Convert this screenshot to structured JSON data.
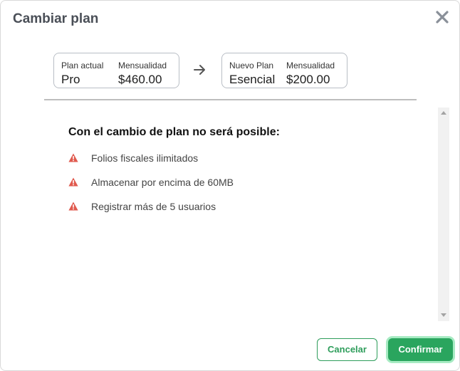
{
  "dialog": {
    "title": "Cambiar plan",
    "close_icon": "close-x-icon"
  },
  "current_plan": {
    "plan_label": "Plan actual",
    "plan_value": "Pro",
    "price_label": "Mensualidad",
    "price_value": "$460.00"
  },
  "transition_icon": "arrow-right-icon",
  "new_plan": {
    "plan_label": "Nuevo Plan",
    "plan_value": "Esencial",
    "price_label": "Mensualidad",
    "price_value": "$200.00"
  },
  "warnings": {
    "heading": "Con el cambio de plan no será posible:",
    "icon": "warning-triangle-icon",
    "items": [
      "Folios fiscales ilimitados",
      "Almacenar por encima de 60MB",
      "Registrar más de 5 usuarios"
    ]
  },
  "actions": {
    "cancel_label": "Cancelar",
    "confirm_label": "Confirmar"
  },
  "colors": {
    "accent": "#2aa55e",
    "warning": "#e05a4e",
    "title": "#4a4f57"
  }
}
